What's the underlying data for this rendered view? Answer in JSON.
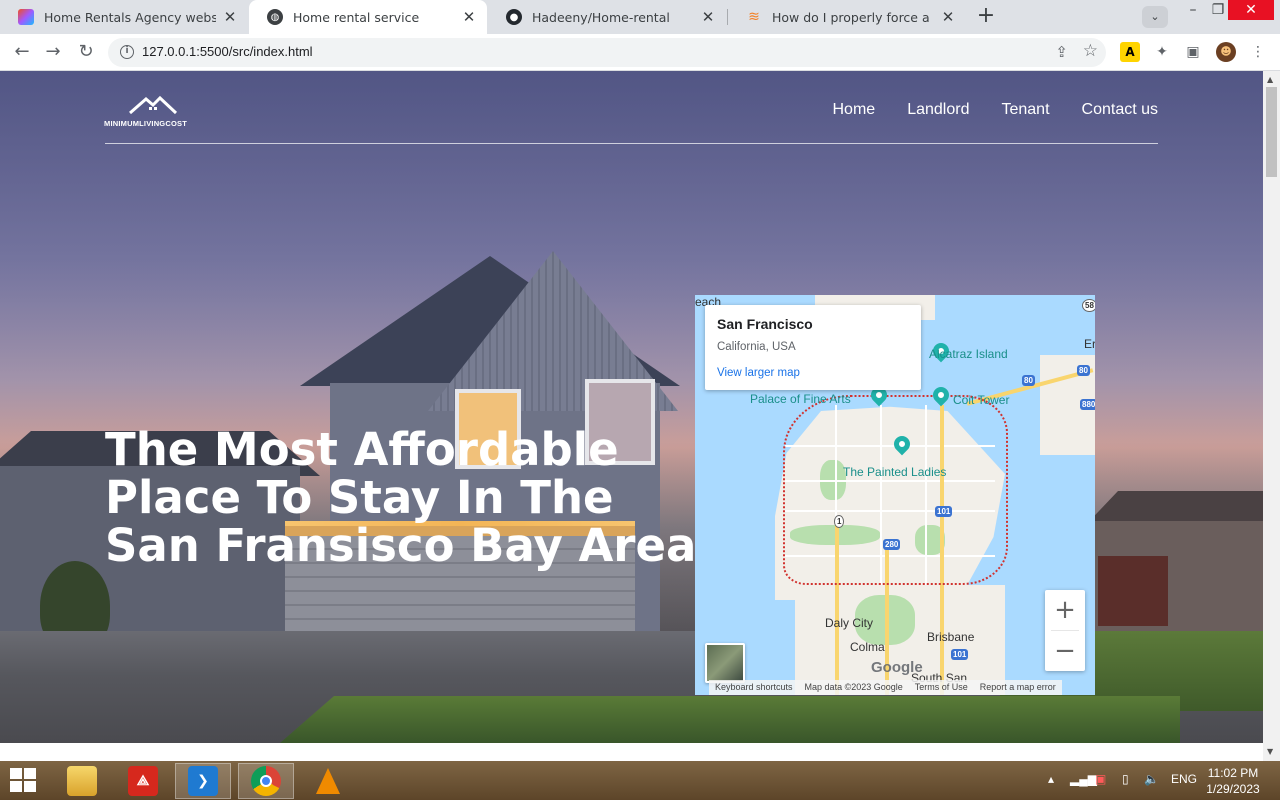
{
  "browser": {
    "tabs": [
      {
        "title": "Home Rentals Agency website de",
        "icon": "figma-icon",
        "active": false
      },
      {
        "title": "Home rental service",
        "icon": "globe-icon",
        "active": true
      },
      {
        "title": "Hadeeny/Home-rental",
        "icon": "github-icon",
        "active": false
      },
      {
        "title": "How do I properly force a Git pus",
        "icon": "stackoverflow-icon",
        "active": false
      }
    ],
    "url": "127.0.0.1:5500/src/index.html"
  },
  "site": {
    "logo_text": "MINIMUMLIVINGCOST",
    "nav": [
      "Home",
      "Landlord",
      "Tenant",
      "Contact us"
    ],
    "headline": [
      "The Most Affordable",
      "Place To Stay In The",
      "San Fransisco Bay Area"
    ]
  },
  "map": {
    "place_name": "San Francisco",
    "place_address": "California, USA",
    "view_larger": "View larger map",
    "labels": {
      "alcatraz": "Alcatraz Island",
      "palace": "Palace of Fine Arts",
      "coit": "Coit Tower",
      "painted": "The Painted Ladies",
      "daly": "Daly City",
      "colma": "Colma",
      "brisbane": "Brisbane",
      "south_san": "South San",
      "beach": "each",
      "er": "Er"
    },
    "shields": [
      "80",
      "80",
      "880",
      "101",
      "1",
      "280",
      "101",
      "58"
    ],
    "google": "Google",
    "attribution": [
      "Keyboard shortcuts",
      "Map data ©2023 Google",
      "Terms of Use",
      "Report a map error"
    ]
  },
  "taskbar": {
    "lang": "ENG",
    "time": "11:02 PM",
    "date": "1/29/2023"
  },
  "colors": {
    "map_water": "#aadaff",
    "poi_teal": "#1a8f8a",
    "link_blue": "#1a73e8",
    "close_red": "#e81123"
  }
}
